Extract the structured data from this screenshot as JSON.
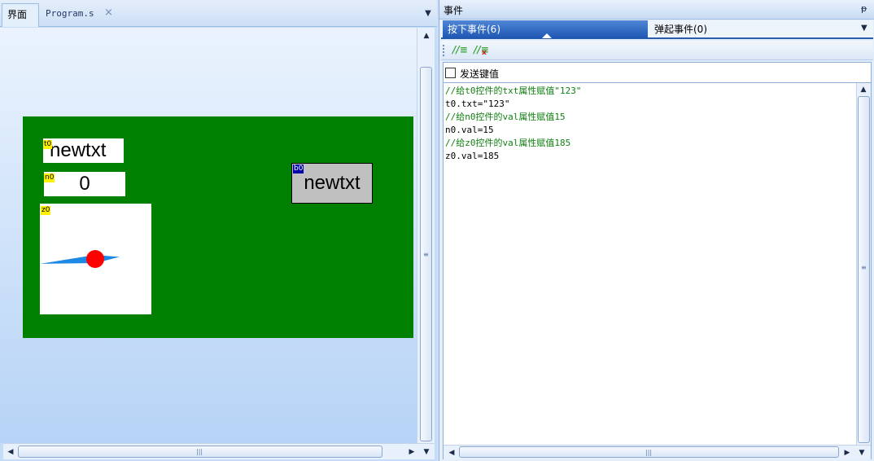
{
  "left_tabs": {
    "design": "界面",
    "program": "Program.s",
    "close": "×",
    "dropdown": "▼"
  },
  "widgets": {
    "t0": {
      "label": "t0",
      "text": "newtxt"
    },
    "n0": {
      "label": "n0",
      "value": "0"
    },
    "z0": {
      "label": "z0",
      "needle_angle": 185
    },
    "b0": {
      "label": "b0",
      "text": "newtxt"
    }
  },
  "colors": {
    "screen_background": "#008000",
    "needle": "#1e88e5",
    "needle_hub": "#ff0000",
    "label_tag": "#fff200"
  },
  "events_panel": {
    "title": "事件",
    "pin": "ᵽ",
    "tabs": [
      {
        "label": "按下事件(6)",
        "active": true
      },
      {
        "label": "弹起事件(0)",
        "active": false
      }
    ],
    "dropdown": "▼",
    "toolbar": {
      "comment_icon": "//≡",
      "uncomment_icon": "//≡",
      "uncomment_mark": "x"
    },
    "send_keys_label": "发送键值",
    "code": [
      {
        "text": "//给t0控件的txt属性赋值\"123\"",
        "kind": "comment"
      },
      {
        "text": "t0.txt=\"123\"",
        "kind": "stmt"
      },
      {
        "text": "//给n0控件的val属性赋值15",
        "kind": "comment"
      },
      {
        "text": "n0.val=15",
        "kind": "stmt"
      },
      {
        "text": "//给z0控件的val属性赋值185",
        "kind": "comment"
      },
      {
        "text": "z0.val=185",
        "kind": "stmt"
      }
    ]
  },
  "scroll_arrows": {
    "up": "▲",
    "down": "▼",
    "left": "◀",
    "right": "▶",
    "grip_v": "≡",
    "grip_h": "|||"
  }
}
